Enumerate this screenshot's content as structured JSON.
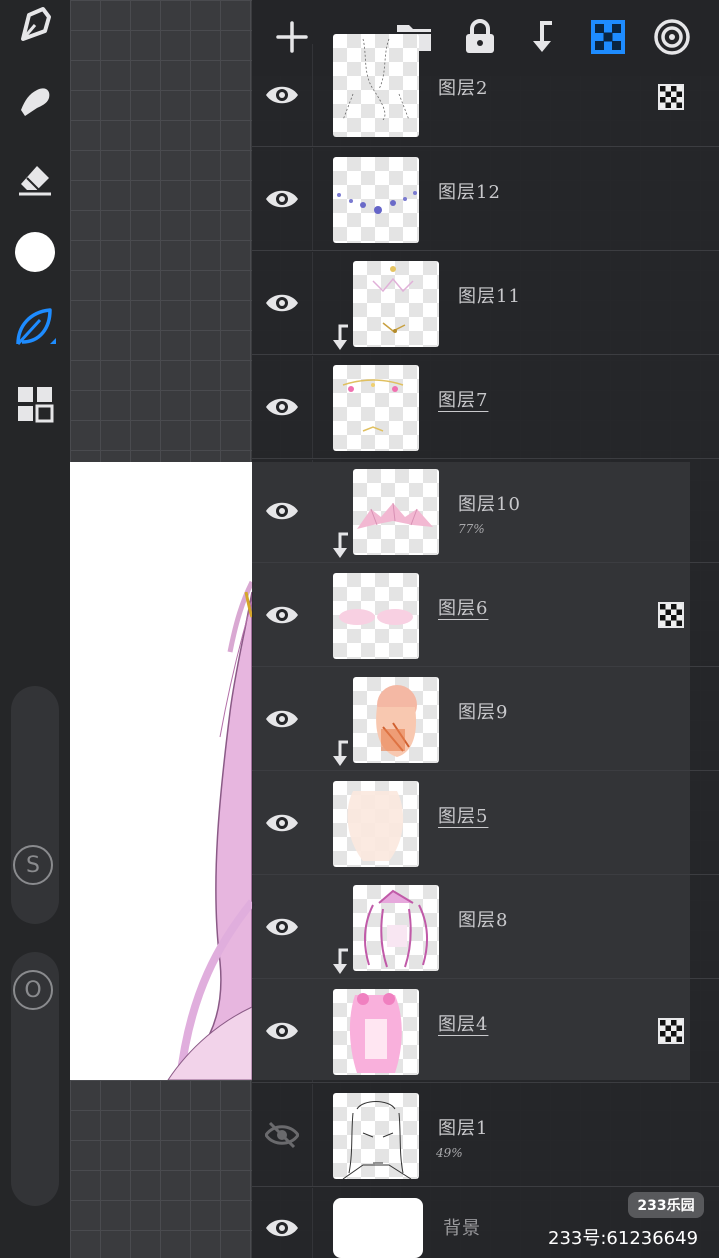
{
  "colors": {
    "accent_blue": "#1e8cff",
    "panel_bg": "#242528",
    "icon_white": "#e6e6e8",
    "hidden_eye": "#6a6a6d"
  },
  "toolbar": {
    "tools": [
      {
        "icon": "pen-nib-icon"
      },
      {
        "icon": "smudge-icon"
      },
      {
        "icon": "eraser-icon"
      },
      {
        "icon": "color-swatch-icon"
      },
      {
        "icon": "leaf-brush-icon"
      },
      {
        "icon": "grid-apps-icon"
      }
    ],
    "size_label": "S",
    "opacity_label": "O"
  },
  "layer_header": {
    "buttons": [
      {
        "icon": "add-icon"
      },
      {
        "icon": "folder-icon"
      },
      {
        "icon": "lock-icon"
      },
      {
        "icon": "merge-down-icon"
      },
      {
        "icon": "transparency-lock-icon",
        "active": true
      },
      {
        "icon": "target-icon"
      }
    ]
  },
  "layers": [
    {
      "name": "图层2",
      "visible": true,
      "clipped": false,
      "mask": true,
      "opacity": ""
    },
    {
      "name": "图层12",
      "visible": true,
      "clipped": false,
      "mask": false,
      "opacity": ""
    },
    {
      "name": "图层11",
      "visible": true,
      "clipped": true,
      "mask": false,
      "opacity": ""
    },
    {
      "name": "图层7",
      "visible": true,
      "clipped": false,
      "mask": false,
      "opacity": "",
      "underlined": true
    },
    {
      "name": "图层10",
      "visible": true,
      "clipped": true,
      "mask": false,
      "opacity": "77%"
    },
    {
      "name": "图层6",
      "visible": true,
      "clipped": false,
      "mask": true,
      "opacity": "",
      "underlined": true
    },
    {
      "name": "图层9",
      "visible": true,
      "clipped": true,
      "mask": false,
      "opacity": ""
    },
    {
      "name": "图层5",
      "visible": true,
      "clipped": false,
      "mask": false,
      "opacity": "",
      "underlined": true
    },
    {
      "name": "图层8",
      "visible": true,
      "clipped": true,
      "mask": false,
      "opacity": ""
    },
    {
      "name": "图层4",
      "visible": true,
      "clipped": false,
      "mask": true,
      "opacity": "",
      "underlined": true
    },
    {
      "name": "图层1",
      "visible": false,
      "clipped": false,
      "mask": false,
      "opacity": "49%"
    },
    {
      "name": "背景",
      "visible": true,
      "clipped": false,
      "mask": false,
      "opacity": ""
    }
  ],
  "watermark": {
    "logo": "233乐园",
    "id_text": "233号:61236649"
  }
}
